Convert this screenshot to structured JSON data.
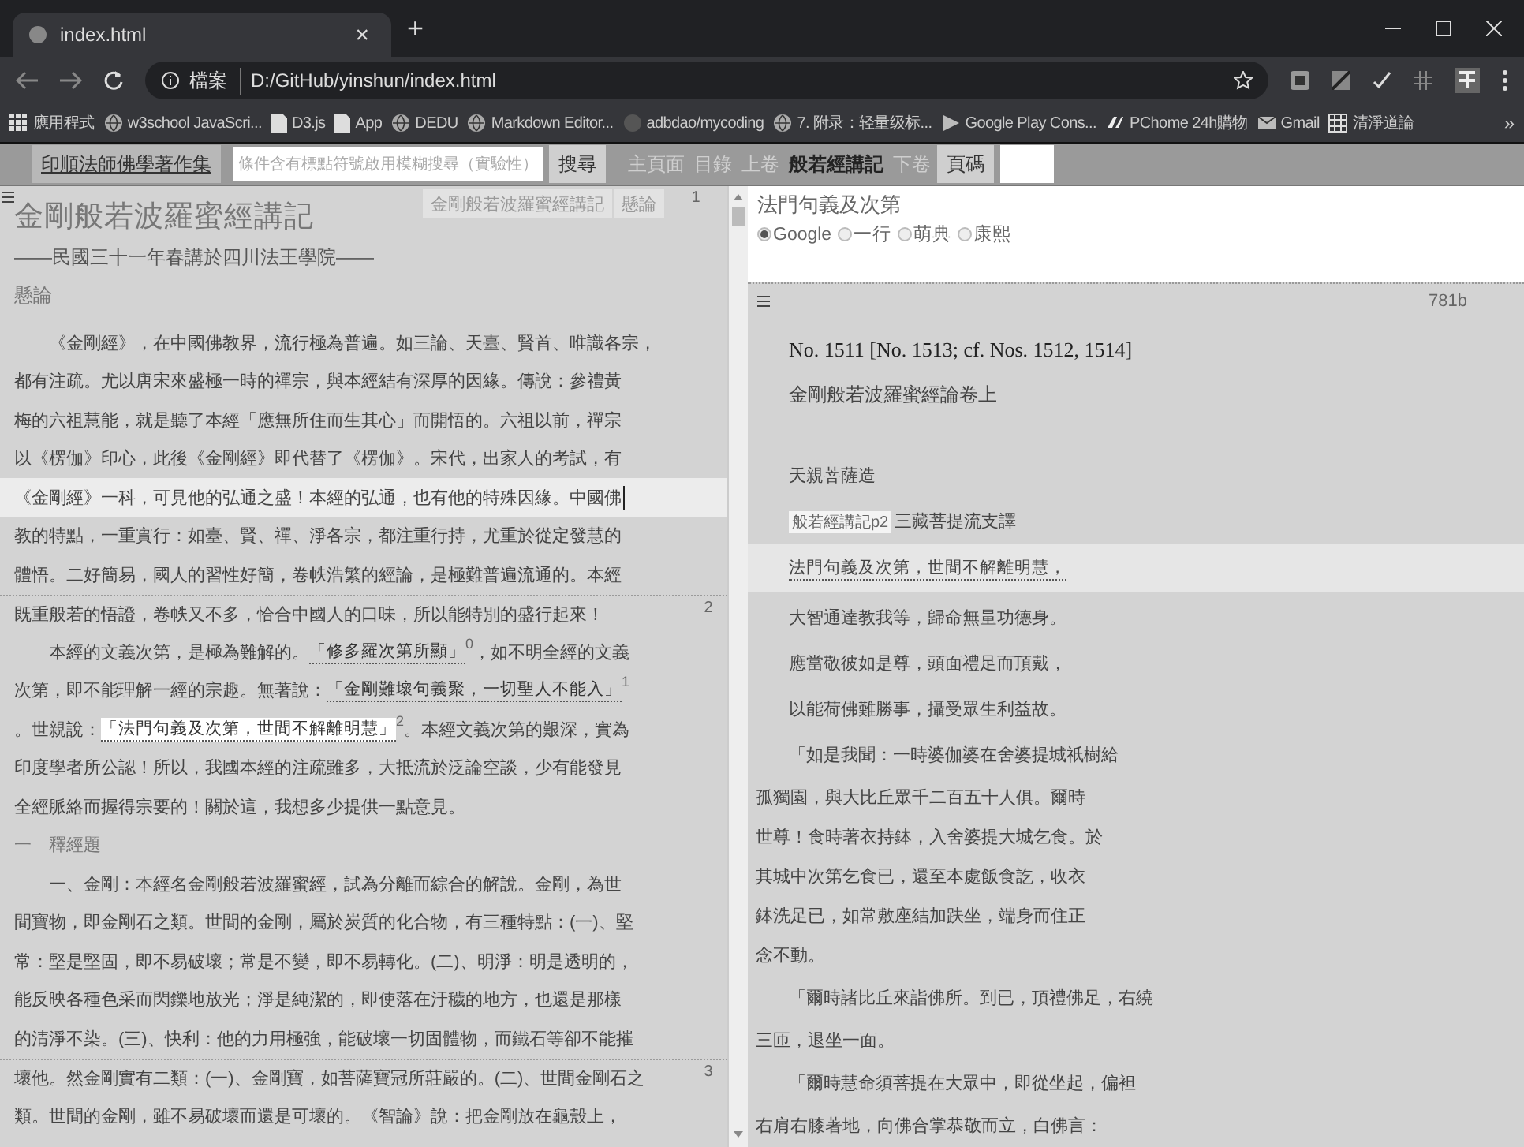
{
  "browser": {
    "tab_title": "index.html",
    "tab_close": "×",
    "new_tab": "+",
    "address_scheme": "檔案",
    "address": "D:/GitHub/yinshun/index.html",
    "bookmarks": [
      {
        "label": "應用程式"
      },
      {
        "label": "w3school JavaScri..."
      },
      {
        "label": "D3.js"
      },
      {
        "label": "App"
      },
      {
        "label": "DEDU"
      },
      {
        "label": "Markdown Editor..."
      },
      {
        "label": "adbdao/mycoding"
      },
      {
        "label": "7. 附录：轻量级标..."
      },
      {
        "label": "Google Play Cons..."
      },
      {
        "label": "PChome 24h購物"
      },
      {
        "label": "Gmail"
      },
      {
        "label": "清淨道論"
      }
    ],
    "bookmarks_more": "»"
  },
  "toolbar": {
    "home_button": "印順法師佛學著作集",
    "search": {
      "placeholder": "條件含有標點符號啟用模糊搜尋（實驗性）"
    },
    "search_button": "搜尋",
    "nav_links": [
      {
        "label": "主頁面",
        "current": false
      },
      {
        "label": "目錄",
        "current": false
      },
      {
        "label": "上卷",
        "current": false
      },
      {
        "label": "般若經講記",
        "current": true
      },
      {
        "label": "下卷",
        "current": false
      }
    ],
    "page_button": "頁碼"
  },
  "document": {
    "title": "金剛般若波羅蜜經講記",
    "breadcrumbs": [
      "金剛般若波羅蜜經講記",
      "懸論"
    ],
    "page_mark": "1",
    "subtitle": "——民國三十一年春講於四川法王學院——",
    "section": "懸論",
    "lines": [
      {
        "kind": "para_start",
        "current": false,
        "text": "《金剛經》，在中國佛教界，流行極為普遍。如三論、天臺、賢首、唯識各宗，"
      },
      {
        "kind": "text",
        "current": false,
        "text": "都有注疏。尤以唐宋來盛極一時的禪宗，與本經結有深厚的因緣。傳說：參禮黃"
      },
      {
        "kind": "text",
        "current": false,
        "text": "梅的六祖慧能，就是聽了本經「應無所住而生其心」而開悟的。六祖以前，禪宗"
      },
      {
        "kind": "text",
        "current": false,
        "text": "以《楞伽》印心，此後《金剛經》即代替了《楞伽》。宋代，出家人的考試，有"
      },
      {
        "kind": "text",
        "current": true,
        "text": "《金剛經》一科，可見他的弘通之盛！本經的弘通，也有他的特殊因緣。中國佛"
      },
      {
        "kind": "text",
        "current": false,
        "text": "教的特點，一重實行：如臺、賢、禪、淨各宗，都注重行持，尤重於從定發慧的"
      },
      {
        "kind": "text",
        "current": false,
        "text": "體悟。二好簡易，國人的習性好簡，卷帙浩繁的經論，是極難普遍流通的。本經"
      },
      {
        "kind": "text",
        "current": false,
        "page_mark": "2",
        "text": "既重般若的悟證，卷帙又不多，恰合中國人的口味，所以能特別的盛行起來！"
      },
      {
        "kind": "para_start",
        "current": false,
        "parts": [
          {
            "kind": "text",
            "text": "本經的文義次第，是極為難解的。"
          },
          {
            "kind": "quote",
            "text": "「修多羅次第所顯」",
            "note": "0",
            "selected": false
          },
          {
            "kind": "text",
            "text": "，如不明全經的文義"
          }
        ]
      },
      {
        "kind": "text",
        "current": false,
        "parts": [
          {
            "kind": "text",
            "text": "次第，即不能理解一經的宗趣。無著說："
          },
          {
            "kind": "quote",
            "text": "「金剛難壞句義聚，一切聖人不能入」",
            "note": "1",
            "selected": false
          }
        ]
      },
      {
        "kind": "text",
        "current": false,
        "parts": [
          {
            "kind": "text",
            "text": "。世親說："
          },
          {
            "kind": "quote",
            "text": "「法門句義及次第，世間不解離明慧」",
            "note": "2",
            "selected": true
          },
          {
            "kind": "text",
            "text": "。本經文義次第的艱深，實為"
          }
        ]
      },
      {
        "kind": "text",
        "current": false,
        "text": "印度學者所公認！所以，我國本經的注疏雖多，大抵流於泛論空談，少有能發見"
      },
      {
        "kind": "text",
        "current": false,
        "text": "全經脈絡而握得宗要的！關於這，我想多少提供一點意見。"
      },
      {
        "kind": "section",
        "current": false,
        "text": "一　釋經題"
      },
      {
        "kind": "para_start",
        "current": false,
        "text": "一、金剛：本經名金剛般若波羅蜜經，試為分離而綜合的解說。金剛，為世"
      },
      {
        "kind": "text",
        "current": false,
        "text": "間寶物，即金剛石之類。世間的金剛，屬於炭質的化合物，有三種特點：(一)、堅"
      },
      {
        "kind": "text",
        "current": false,
        "text": "常：堅是堅固，即不易破壞；常是不變，即不易轉化。(二)、明淨：明是透明的，"
      },
      {
        "kind": "text",
        "current": false,
        "text": "能反映各種色采而閃鑠地放光；淨是純潔的，即使落在汙穢的地方，也還是那樣"
      },
      {
        "kind": "text",
        "current": false,
        "text": "的清淨不染。(三)、快利：他的力用極強，能破壞一切固體物，而鐵石等卻不能摧"
      },
      {
        "kind": "text",
        "current": false,
        "page_mark": "3",
        "text": "壞他。然金剛實有二類：(一)、金剛寶，如菩薩寶冠所莊嚴的。(二)、世間金剛石之"
      },
      {
        "kind": "text",
        "current": false,
        "text": "類。世間的金剛，雖不易破壞而還是可壞的。《智論》說：把金剛放在龜殼上，"
      }
    ]
  },
  "lookup": {
    "term": "法門句義及次第",
    "sources": [
      {
        "label": "Google",
        "selected": true
      },
      {
        "label": "一行",
        "selected": false
      },
      {
        "label": "萌典",
        "selected": false
      },
      {
        "label": "康熙",
        "selected": false
      }
    ]
  },
  "reader": {
    "page_id": "781b",
    "lines": [
      {
        "kind": "ref",
        "current": false,
        "text": "No. 1511 [No. 1513; cf. Nos. 1512, 1514]"
      },
      {
        "kind": "title",
        "current": false,
        "text": "金剛般若波羅蜜經論卷上"
      },
      {
        "kind": "verse",
        "current": false,
        "text": "天親菩薩造"
      },
      {
        "kind": "verse",
        "current": false,
        "tooltip": "般若經講記p2",
        "text": "三藏菩提流支譯"
      },
      {
        "kind": "quote",
        "current": true,
        "text": "法門句義及次第，世間不解離明慧，"
      },
      {
        "kind": "verse",
        "current": false,
        "text": "大智通達教我等，歸命無量功德身。"
      },
      {
        "kind": "verse",
        "current": false,
        "text": "應當敬彼如是尊，頭面禮足而頂戴，"
      },
      {
        "kind": "verse",
        "current": false,
        "text": "以能荷佛難勝事，攝受眾生利益故。"
      },
      {
        "kind": "para_start",
        "current": false,
        "text": "「如是我聞：一時婆伽婆在舍婆提城祇樹給"
      },
      {
        "kind": "text",
        "current": false,
        "text": "孤獨園，與大比丘眾千二百五十人俱。爾時"
      },
      {
        "kind": "text",
        "current": false,
        "text": "世尊！食時著衣持鉢，入舍婆提大城乞食。於"
      },
      {
        "kind": "text",
        "current": false,
        "text": "其城中次第乞食已，還至本處飯食訖，收衣"
      },
      {
        "kind": "text",
        "current": false,
        "text": "鉢洗足已，如常敷座結加趺坐，端身而住正"
      },
      {
        "kind": "text",
        "current": false,
        "text": "念不動。"
      },
      {
        "kind": "para_start",
        "current": false,
        "text": "「爾時諸比丘來詣佛所。到已，頂禮佛足，右繞"
      },
      {
        "kind": "text",
        "current": false,
        "text": "三匝，退坐一面。"
      },
      {
        "kind": "para_start",
        "current": false,
        "text": "「爾時慧命須菩提在大眾中，即從坐起，偏袒"
      },
      {
        "kind": "text",
        "current": false,
        "text": "右肩右膝著地，向佛合掌恭敬而立，白佛言："
      }
    ]
  }
}
